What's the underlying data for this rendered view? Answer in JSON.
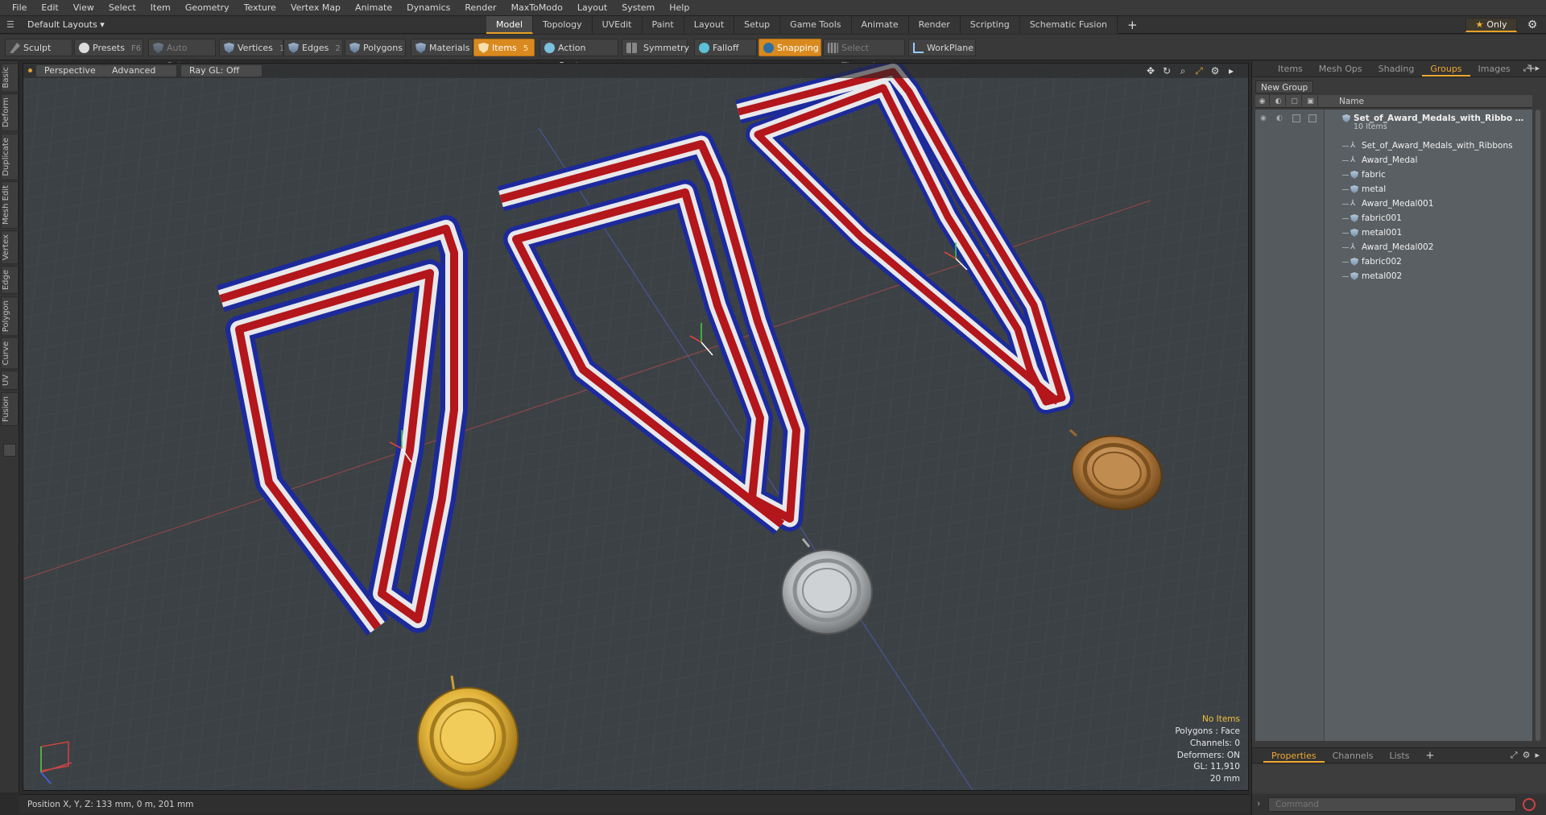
{
  "menubar": [
    "File",
    "Edit",
    "View",
    "Select",
    "Item",
    "Geometry",
    "Texture",
    "Vertex Map",
    "Animate",
    "Dynamics",
    "Render",
    "MaxToModo",
    "Layout",
    "System",
    "Help"
  ],
  "layout": {
    "select_label": "Default Layouts ▾",
    "tabs": [
      "Model",
      "Topology",
      "UVEdit",
      "Paint",
      "Layout",
      "Setup",
      "Game Tools",
      "Animate",
      "Render",
      "Scripting",
      "Schematic Fusion"
    ],
    "active_tab": "Model",
    "plus": "+",
    "only_label": "Only"
  },
  "toolbar": {
    "sculpt": "Sculpt",
    "presets": "Presets",
    "presets_key": "F6",
    "auto_select": "Auto Select",
    "vertices": "Vertices",
    "vertices_key": "1",
    "edges": "Edges",
    "edges_key": "2",
    "polygons": "Polygons",
    "materials": "Materials",
    "items": "Items",
    "items_key": "5",
    "action_center": "Action Center",
    "symmetry": "Symmetry",
    "falloff": "Falloff",
    "snapping": "Snapping",
    "select_through": "Select Through",
    "workplane": "WorkPlane"
  },
  "left_tabs": [
    "Basic",
    "Deform",
    "Duplicate",
    "Mesh Edit",
    "Vertex",
    "Edge",
    "Polygon",
    "Curve",
    "UV",
    "Fusion"
  ],
  "viewport": {
    "view_mode": "Perspective",
    "shading": "Advanced",
    "raygl": "Ray GL: Off",
    "info": {
      "no_items": "No Items",
      "polygons": "Polygons : Face",
      "channels": "Channels: 0",
      "deformers": "Deformers: ON",
      "gl": "GL: 11,910",
      "unit": "20 mm"
    }
  },
  "status": {
    "position": "Position X, Y, Z:   133 mm, 0 m, 201 mm"
  },
  "right_panel": {
    "tabs": [
      "Items",
      "Mesh Ops",
      "Shading",
      "Groups",
      "Images"
    ],
    "active_tab": "Groups",
    "plus": "+",
    "new_group": "New Group",
    "col_name": "Name",
    "root": {
      "label": "Set_of_Award_Medals_with_Ribbo …",
      "count": "10 Items"
    },
    "items": [
      {
        "label": "Set_of_Award_Medals_with_Ribbons",
        "icon": "locator-icon"
      },
      {
        "label": "Award_Medal",
        "icon": "locator-icon"
      },
      {
        "label": "fabric",
        "icon": "mesh-icon"
      },
      {
        "label": "metal",
        "icon": "mesh-icon"
      },
      {
        "label": "Award_Medal001",
        "icon": "locator-icon"
      },
      {
        "label": "fabric001",
        "icon": "mesh-icon"
      },
      {
        "label": "metal001",
        "icon": "mesh-icon"
      },
      {
        "label": "Award_Medal002",
        "icon": "locator-icon"
      },
      {
        "label": "fabric002",
        "icon": "mesh-icon"
      },
      {
        "label": "metal002",
        "icon": "mesh-icon"
      }
    ],
    "bottom_tabs": [
      "Properties",
      "Channels",
      "Lists"
    ],
    "bottom_active": "Properties",
    "command_placeholder": "Command"
  },
  "colors": {
    "accent": "#e6a128",
    "ribbon_red": "#b3161b",
    "ribbon_white": "#e8e8ea",
    "ribbon_blue": "#1c2a9c",
    "gold": "#e3b53c",
    "silver": "#b7bbbe",
    "bronze": "#b07a3e"
  }
}
